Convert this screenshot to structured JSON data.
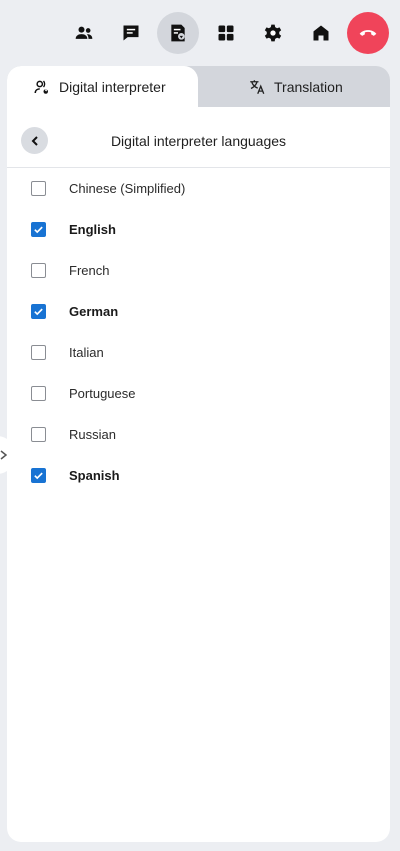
{
  "toolbar": {
    "buttons": [
      {
        "id": "participants",
        "icon": "people-icon"
      },
      {
        "id": "chat",
        "icon": "chat-icon"
      },
      {
        "id": "interpreter",
        "icon": "interpreter-icon",
        "active": true
      },
      {
        "id": "apps",
        "icon": "grid-icon"
      },
      {
        "id": "settings",
        "icon": "gear-icon"
      },
      {
        "id": "home",
        "icon": "home-icon"
      },
      {
        "id": "end-call",
        "icon": "phone-hangup-icon",
        "color": "#f0445a"
      }
    ]
  },
  "tabs": {
    "digital_interpreter": "Digital interpreter",
    "translation": "Translation"
  },
  "panel": {
    "title": "Digital interpreter languages"
  },
  "languages": [
    {
      "label": "Chinese (Simplified)",
      "checked": false
    },
    {
      "label": "English",
      "checked": true
    },
    {
      "label": "French",
      "checked": false
    },
    {
      "label": "German",
      "checked": true
    },
    {
      "label": "Italian",
      "checked": false
    },
    {
      "label": "Portuguese",
      "checked": false
    },
    {
      "label": "Russian",
      "checked": false
    },
    {
      "label": "Spanish",
      "checked": true
    }
  ],
  "colors": {
    "accent": "#1873d3",
    "end_call": "#f0445a",
    "background": "#eceef2"
  }
}
